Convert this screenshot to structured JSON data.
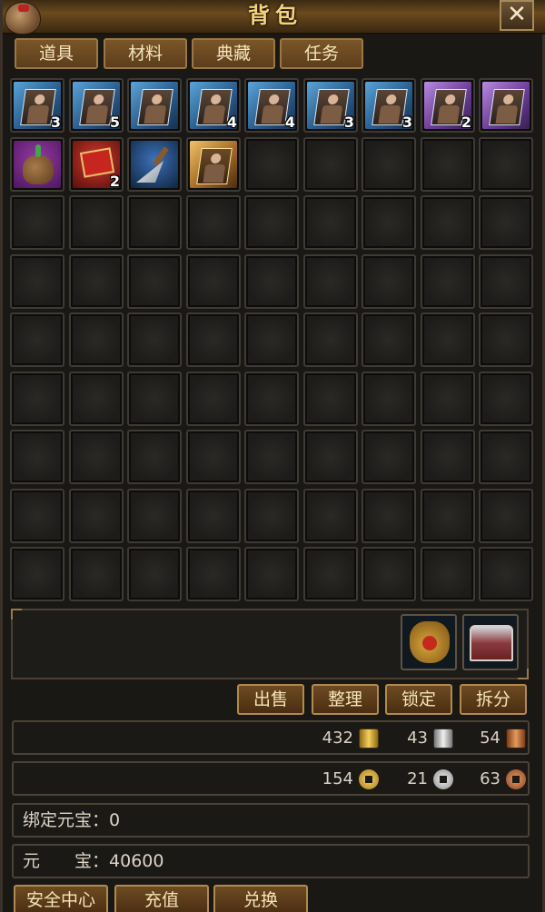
{
  "window": {
    "title": "背包",
    "close_label": "✕"
  },
  "tabs": [
    {
      "label": "道具"
    },
    {
      "label": "材料"
    },
    {
      "label": "典藏"
    },
    {
      "label": "任务"
    }
  ],
  "items": [
    {
      "icon": "hero-card-icon",
      "rarity": "blue",
      "qty": "3"
    },
    {
      "icon": "hero-card-icon",
      "rarity": "blue",
      "qty": "5"
    },
    {
      "icon": "hero-card-icon",
      "rarity": "blue",
      "qty": ""
    },
    {
      "icon": "hero-card-icon",
      "rarity": "blue",
      "qty": "4"
    },
    {
      "icon": "hero-card-icon",
      "rarity": "blue",
      "qty": "4"
    },
    {
      "icon": "hero-card-icon",
      "rarity": "blue",
      "qty": "3"
    },
    {
      "icon": "hero-card-icon",
      "rarity": "blue",
      "qty": "3"
    },
    {
      "icon": "hero-card-icon",
      "rarity": "purple",
      "qty": "2"
    },
    {
      "icon": "hero-card-icon",
      "rarity": "purple",
      "qty": ""
    },
    {
      "icon": "seed-bag-icon",
      "rarity": "purple",
      "qty": ""
    },
    {
      "icon": "red-scroll-icon",
      "rarity": "red",
      "qty": "2"
    },
    {
      "icon": "trowel-icon",
      "rarity": "blue",
      "qty": ""
    },
    {
      "icon": "hero-card-icon",
      "rarity": "gold",
      "qty": ""
    }
  ],
  "actions": {
    "sell": "出售",
    "sort": "整理",
    "lock": "锁定",
    "split": "拆分"
  },
  "ingots": {
    "gold": "432",
    "silver": "43",
    "bronze": "54"
  },
  "coins": {
    "gold": "154",
    "silver": "21",
    "bronze": "63"
  },
  "bound_yuanbao": {
    "label": "绑定元宝：",
    "value": "0"
  },
  "yuanbao": {
    "label": "元　　宝：",
    "value": "40600"
  },
  "bottom": {
    "security": "安全中心",
    "recharge": "充值",
    "exchange": "兑换"
  }
}
